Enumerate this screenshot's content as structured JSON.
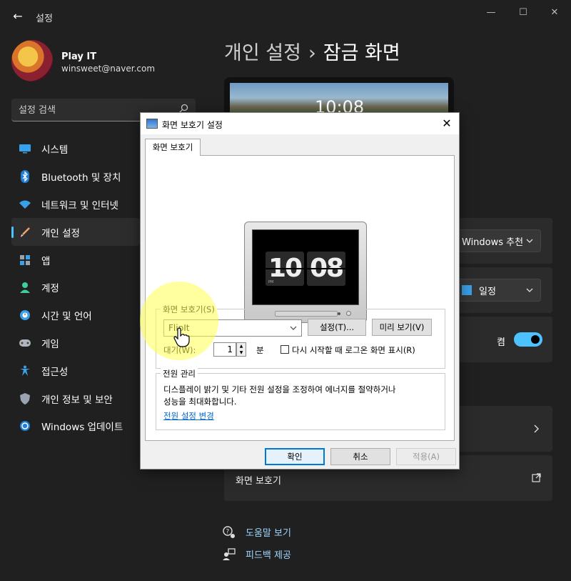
{
  "window": {
    "app_title": "설정",
    "controls": {
      "minimize": "—",
      "maximize": "☐",
      "close": "✕"
    },
    "back": "←"
  },
  "profile": {
    "name": "Play IT",
    "email": "winsweet@naver.com"
  },
  "search": {
    "placeholder": "설정 검색"
  },
  "nav": {
    "items": [
      {
        "label": "시스템",
        "icon": "monitor-icon"
      },
      {
        "label": "Bluetooth 및 장치",
        "icon": "bluetooth-icon"
      },
      {
        "label": "네트워크 및 인터넷",
        "icon": "wifi-icon"
      },
      {
        "label": "개인 설정",
        "icon": "brush-icon",
        "active": true
      },
      {
        "label": "앱",
        "icon": "apps-icon"
      },
      {
        "label": "계정",
        "icon": "person-icon"
      },
      {
        "label": "시간 및 언어",
        "icon": "globe-clock-icon"
      },
      {
        "label": "게임",
        "icon": "gamepad-icon"
      },
      {
        "label": "접근성",
        "icon": "accessibility-icon"
      },
      {
        "label": "개인 정보 및 보안",
        "icon": "shield-icon"
      },
      {
        "label": "Windows 업데이트",
        "icon": "update-icon"
      }
    ]
  },
  "page": {
    "breadcrumb_parent": "개인 설정",
    "breadcrumb_sep": "›",
    "breadcrumb_current": "잠금 화면",
    "preview_time": "10:08",
    "personalize_value": "Windows 추천",
    "status_value": "일정",
    "toggle_label": "켬",
    "screensaver_label": "화면 보호기",
    "help_link": "도움말 보기",
    "feedback_link": "피드백 제공"
  },
  "dialog": {
    "title": "화면 보호기 설정",
    "close": "✕",
    "tab": "화면 보호기",
    "preview": {
      "hour": "10",
      "minute": "08",
      "ampm": "PM"
    },
    "screensaver_group": "화면 보호기(S)",
    "screensaver_value": "FlipIt",
    "settings_button": "설정(T)...",
    "preview_button": "미리 보기(V)",
    "wait_label": "대기(W):",
    "wait_value": "1",
    "wait_unit": "분",
    "resume_checkbox": "다시 시작할 때 로그온 화면 표시(R)",
    "resume_checked": false,
    "power_group": "전원 관리",
    "power_text_1": "디스플레이 밝기 및 기타 전원 설정을 조정하여 에너지를 절약하거나",
    "power_text_2": "성능을 최대화합니다.",
    "power_link": "전원 설정 변경",
    "ok": "확인",
    "cancel": "취소",
    "apply": "적용(A)"
  },
  "colors": {
    "accent": "#4cc2ff",
    "window_bg": "#202020",
    "card_bg": "#2b2b2b"
  }
}
